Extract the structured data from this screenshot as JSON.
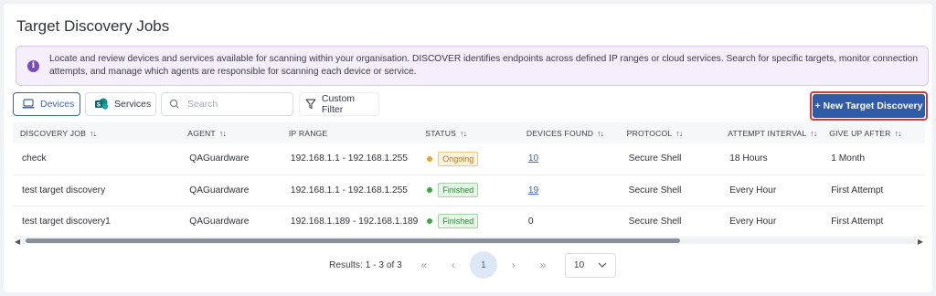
{
  "page": {
    "title": "Target Discovery Jobs",
    "info": "Locate and review devices and services available for scanning within your organisation. DISCOVER identifies endpoints across defined IP ranges or cloud services. Search for specific targets, monitor connection attempts, and manage which agents are responsible for scanning each device or service."
  },
  "toolbar": {
    "tab_devices": "Devices",
    "tab_services": "Services",
    "search_placeholder": "Search",
    "custom_filter": "Custom Filter",
    "new_button": "+ New Target Discovery"
  },
  "table": {
    "headers": [
      "DISCOVERY JOB",
      "AGENT",
      "IP RANGE",
      "STATUS",
      "DEVICES FOUND",
      "PROTOCOL",
      "ATTEMPT INTERVAL",
      "GIVE UP AFTER"
    ],
    "rows": [
      {
        "job": "check",
        "agent": "QAGuardware",
        "ip": "192.168.1.1 - 192.168.1.255",
        "status": "Ongoing",
        "found": "10",
        "protocol": "Secure Shell",
        "interval": "18 Hours",
        "giveup": "1 Month"
      },
      {
        "job": "test target discovery",
        "agent": "QAGuardware",
        "ip": "192.168.1.1 - 192.168.1.255",
        "status": "Finished",
        "found": "19",
        "protocol": "Secure Shell",
        "interval": "Every Hour",
        "giveup": "First Attempt"
      },
      {
        "job": "test target discovery1",
        "agent": "QAGuardware",
        "ip": "192.168.1.189 - 192.168.1.189",
        "status": "Finished",
        "found": "0",
        "protocol": "Secure Shell",
        "interval": "Every Hour",
        "giveup": "First Attempt"
      }
    ]
  },
  "pagination": {
    "results": "Results: 1 - 3 of 3",
    "current_page": "1",
    "page_size": "10"
  },
  "colors": {
    "accent": "#2f5ba8",
    "ongoing": "#e8a23a",
    "finished": "#3fa64a"
  }
}
